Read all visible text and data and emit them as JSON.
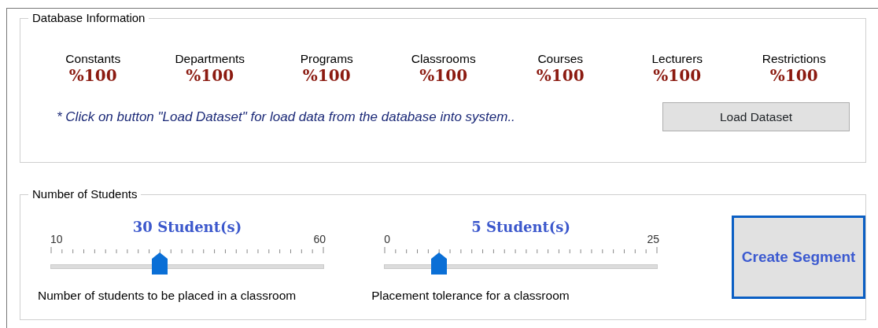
{
  "database_information": {
    "title": "Database Information",
    "stats": [
      {
        "label": "Constants",
        "value": "%100"
      },
      {
        "label": "Departments",
        "value": "%100"
      },
      {
        "label": "Programs",
        "value": "%100"
      },
      {
        "label": "Classrooms",
        "value": "%100"
      },
      {
        "label": "Courses",
        "value": "%100"
      },
      {
        "label": "Lecturers",
        "value": "%100"
      },
      {
        "label": "Restrictions",
        "value": "%100"
      }
    ],
    "note": "* Click on button \"Load Dataset\" for load data from the database into system..",
    "load_button": "Load Dataset"
  },
  "number_of_students": {
    "title": "Number of Students",
    "sliders": [
      {
        "reading": "30 Student(s)",
        "min": "10",
        "max": "60",
        "level": 0.4,
        "caption": "Number of students to be placed in a classroom"
      },
      {
        "reading": "5 Student(s)",
        "min": "0",
        "max": "25",
        "level": 0.2,
        "caption": "Placement tolerance for a classroom"
      }
    ],
    "create_button": "Create Segment"
  }
}
